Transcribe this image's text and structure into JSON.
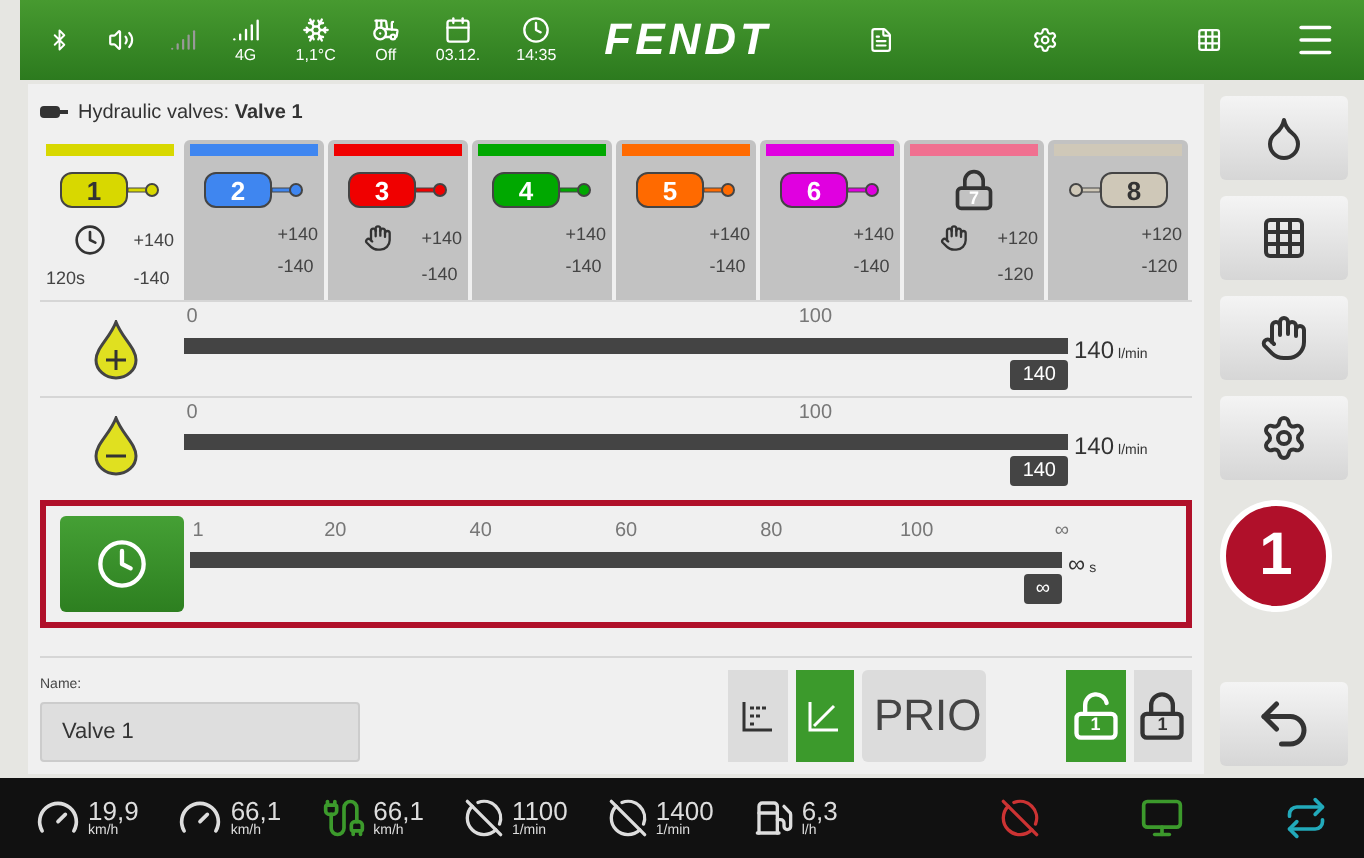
{
  "top_bar": {
    "network": "4G",
    "temperature": "1,1°C",
    "pto": "Off",
    "date": "03.12.",
    "time": "14:35",
    "brand": "FENDT"
  },
  "panel": {
    "title": "Hydraulic valves: **Valve 1**"
  },
  "valves": [
    {
      "kind": "cylinder",
      "number": "1",
      "color": "#d8d800",
      "selected": true,
      "hand_control": false,
      "timer": "120s",
      "plus": "+140",
      "minus": "-140"
    },
    {
      "kind": "cylinder",
      "number": "2",
      "color": "#3f86f0",
      "selected": false,
      "hand_control": false,
      "plus": "+140",
      "minus": "-140"
    },
    {
      "kind": "cylinder",
      "number": "3",
      "color": "#f00000",
      "selected": false,
      "hand_control": true,
      "plus": "+140",
      "minus": "-140"
    },
    {
      "kind": "cylinder",
      "number": "4",
      "color": "#00a800",
      "selected": false,
      "hand_control": false,
      "plus": "+140",
      "minus": "-140"
    },
    {
      "kind": "cylinder",
      "number": "5",
      "color": "#ff6a00",
      "selected": false,
      "hand_control": false,
      "plus": "+140",
      "minus": "-140"
    },
    {
      "kind": "cylinder",
      "number": "6",
      "color": "#e000e0",
      "selected": false,
      "hand_control": false,
      "plus": "+140",
      "minus": "-140"
    },
    {
      "kind": "locked",
      "number": "7",
      "color": "#f07090",
      "selected": false,
      "hand_control": true,
      "plus": "+120",
      "minus": "-120"
    },
    {
      "kind": "reversed",
      "number": "8",
      "color": "#cfc8b8",
      "selected": false,
      "hand_control": false,
      "plus": "+120",
      "minus": "-120"
    }
  ],
  "sliders": [
    {
      "kind": "plus",
      "ticks": [
        "0",
        "100"
      ],
      "reading": "140",
      "unit": "l/min",
      "badge": "140",
      "level": 1,
      "highlighted": false
    },
    {
      "kind": "minus",
      "ticks": [
        "0",
        "100"
      ],
      "reading": "140",
      "unit": "l/min",
      "badge": "140",
      "level": 1,
      "highlighted": false
    },
    {
      "kind": "timer",
      "ticks": [
        "1",
        "20",
        "40",
        "60",
        "80",
        "100",
        "∞"
      ],
      "reading": "∞",
      "unit": "s",
      "badge": "∞",
      "level": 1,
      "highlighted": true
    }
  ],
  "callout": "1",
  "name_field": {
    "label": "Name:",
    "value": "Valve 1"
  },
  "mode_buttons": [
    {
      "kind": "steps",
      "selected": false
    },
    {
      "kind": "ramp",
      "selected": true
    }
  ],
  "prio": "PRIO",
  "lock_buttons": [
    {
      "kind": "unlocked",
      "number": "1",
      "selected": true
    },
    {
      "kind": "locked",
      "number": "1",
      "selected": false
    }
  ],
  "footer": [
    {
      "kind": "speed",
      "value": "19,9",
      "unit": "km/h"
    },
    {
      "kind": "speed",
      "value": "66,1",
      "unit": "km/h"
    },
    {
      "kind": "radar",
      "value": "66,1",
      "unit": "km/h"
    },
    {
      "kind": "engine",
      "value": "1100",
      "unit": "1/min"
    },
    {
      "kind": "engine",
      "value": "1400",
      "unit": "1/min"
    },
    {
      "kind": "fuel",
      "value": "6,3",
      "unit": "l/h"
    }
  ]
}
